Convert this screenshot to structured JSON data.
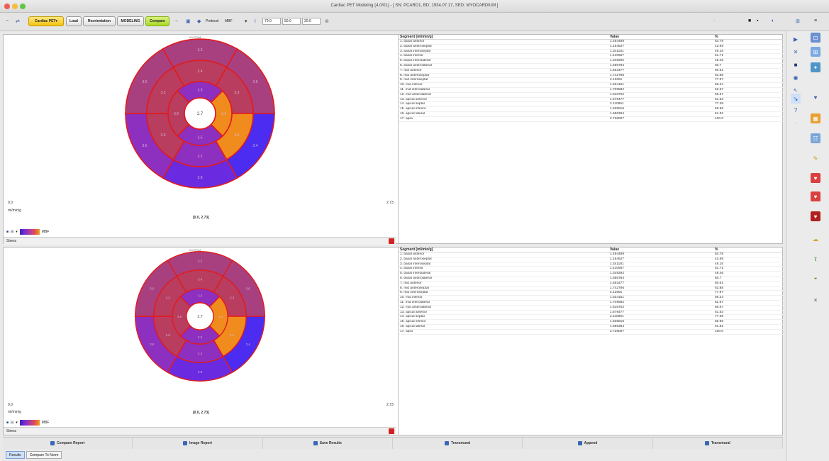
{
  "window": {
    "title": "Cardiac PET Modeling (4.0/01) - [ SN: PCARD1, BD: 1934.07.17, SED: MYOCARDIUM ]"
  },
  "toolbar": {
    "cardiac_pet_label": "Cardiac PET",
    "load_label": "Load",
    "reorientation_label": "Reorientation",
    "modeling_label": "MODELING",
    "compare_label": "Compare",
    "protocol_label": "Protocol",
    "mbf_label": "MBF",
    "field1_value": "70.0",
    "field2_value": "50.0",
    "field3_value": "20.0"
  },
  "polar": {
    "header": "MYOSIM",
    "apex_value": "2.7",
    "min_value": "0.0",
    "max_value": "2.73",
    "range_label": "[0.0, 2.73]",
    "unit_label": "ml/min/g",
    "colorbar_label": "MBF",
    "mode_label": "Stress",
    "ring_labels": {
      "basal": [
        "3.2",
        "3.6",
        "3.4",
        "3.8",
        "3.6",
        "3.0"
      ],
      "mid": [
        "3.4",
        "3.3",
        "3.4",
        "3.2",
        "3.6",
        "3.2"
      ],
      "apical": [
        "3.3",
        "3.4",
        "3.5",
        "3.6"
      ]
    },
    "colors": {
      "blue": "#6a2be0",
      "purple": "#8d2fbf",
      "mauve": "#a8407f",
      "red": "#b93d5f",
      "orange": "#f08c1e",
      "deep": "#4b2cf0"
    }
  },
  "table": {
    "headers": [
      "Segment [ml/min/g]",
      "Value",
      "%"
    ],
    "rows": [
      [
        "1. basal anterior",
        "1.494489",
        "54.78"
      ],
      [
        "2. basal anteroseptal",
        "1.164527",
        "42.69"
      ],
      [
        "3. basal inferoseptal",
        "1.341181",
        "49.16"
      ],
      [
        "4. basal inferior",
        "1.410557",
        "51.71"
      ],
      [
        "5. basal inferolateral",
        "1.349292",
        "49.46"
      ],
      [
        "6. basal anterolateral",
        "1.655784",
        "60.7"
      ],
      [
        "7. mid anterior",
        "1.653477",
        "60.61"
      ],
      [
        "8. mid anteroseptal",
        "1.742786",
        "63.88"
      ],
      [
        "9. mid inferoseptal",
        "2.12691",
        "77.97"
      ],
      [
        "10. mid inferior",
        "1.534151",
        "56.24"
      ],
      [
        "11. mid inferolateral",
        "1.709582",
        "62.67"
      ],
      [
        "12. mid anterolateral",
        "1.818702",
        "66.67"
      ],
      [
        "13. apical anterior",
        "1.679477",
        "61.53"
      ],
      [
        "14. apical septal",
        "2.110961",
        "77.38"
      ],
      [
        "15. apical inferior",
        "1.635816",
        "59.96"
      ],
      [
        "16. apical lateral",
        "1.686394",
        "61.82"
      ],
      [
        "17. apex",
        "2.728007",
        "100.0"
      ]
    ]
  },
  "bottom_buttons": [
    "Compare Report",
    "Image Report",
    "Save Results",
    "Transmural",
    "Append",
    "Transmural"
  ],
  "tabs": [
    "Results",
    "Compare To Norm"
  ]
}
